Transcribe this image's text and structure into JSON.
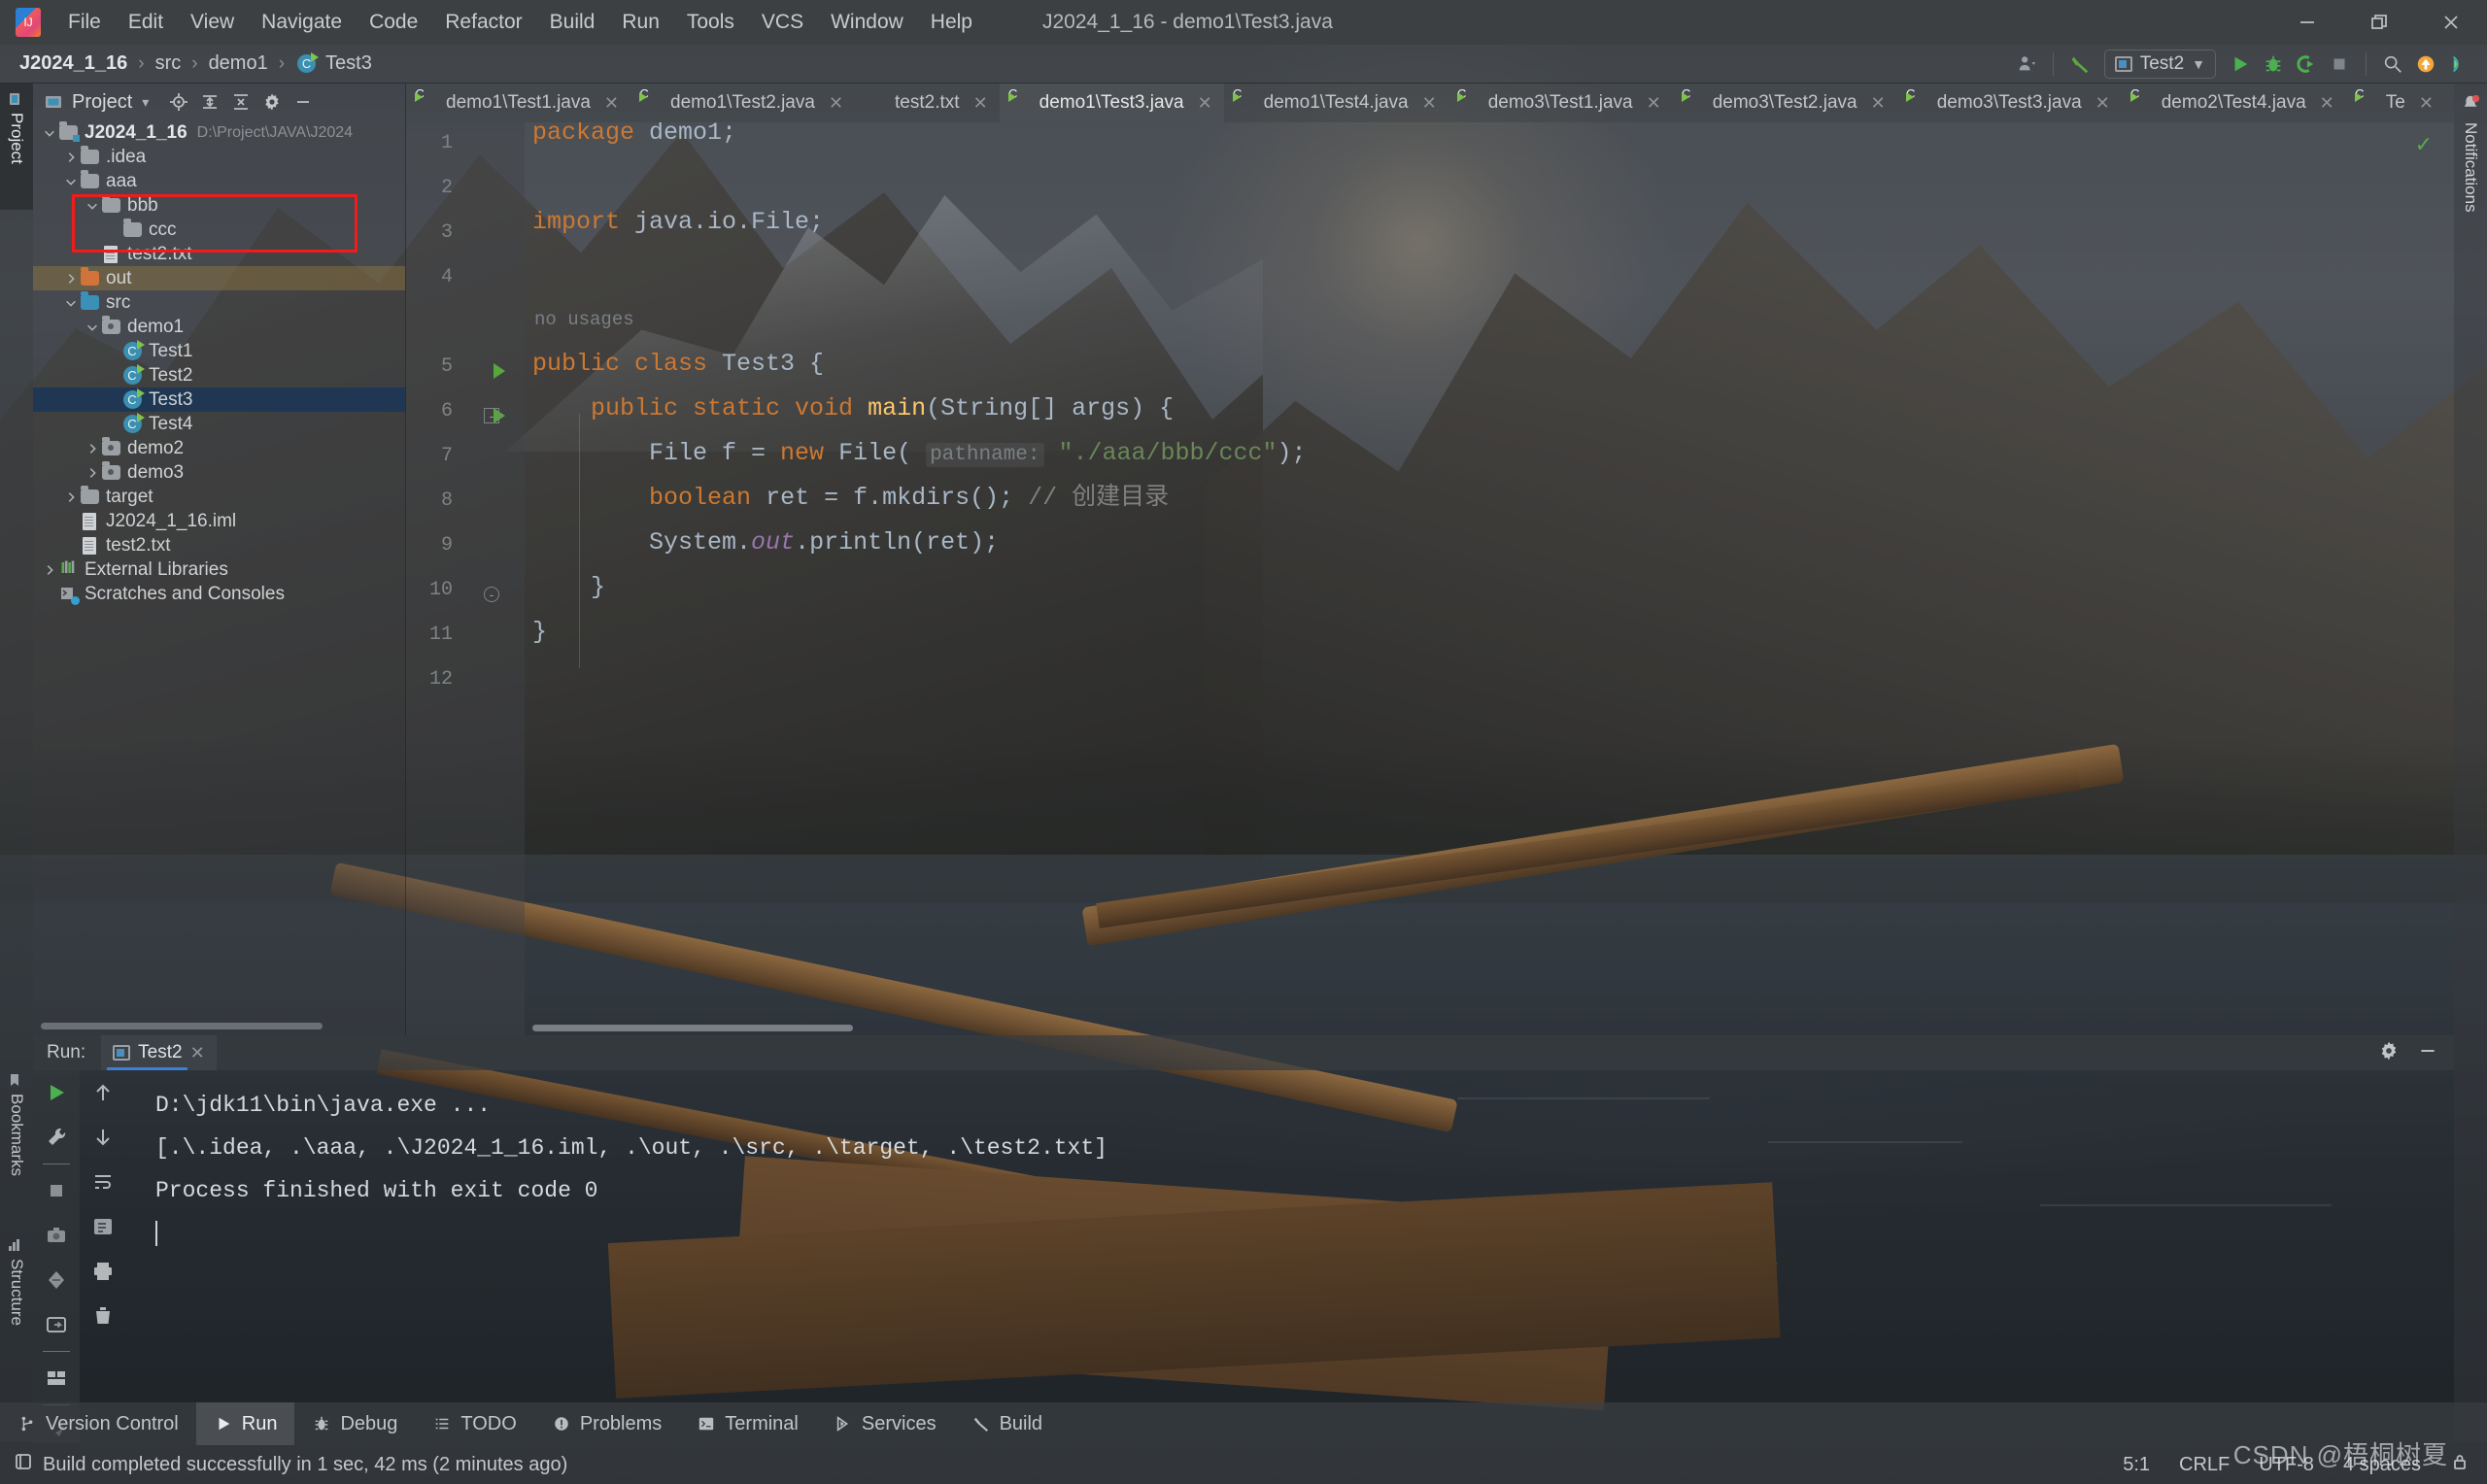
{
  "window": {
    "title": "J2024_1_16 - demo1\\Test3.java",
    "minimize": "—",
    "restore": "❐",
    "close": "✕"
  },
  "menubar": {
    "items": [
      "File",
      "Edit",
      "View",
      "Navigate",
      "Code",
      "Refactor",
      "Build",
      "Run",
      "Tools",
      "VCS",
      "Window",
      "Help"
    ]
  },
  "breadcrumb": {
    "items": [
      "J2024_1_16",
      "src",
      "demo1",
      "Test3"
    ],
    "separator": "›"
  },
  "toolbar": {
    "run_config_label": "Test2",
    "icons": [
      "user-icon",
      "hammer-icon",
      "run-icon",
      "debug-icon",
      "run-coverage-icon",
      "stop-icon",
      "search-icon",
      "update-icon",
      "ide-assistant-icon"
    ],
    "run_config_caret": "▼"
  },
  "left_strip": {
    "project_tab": "Project",
    "bookmarks_tab": "Bookmarks",
    "structure_tab": "Structure"
  },
  "right_strip": {
    "notifications_tab": "Notifications"
  },
  "project_panel": {
    "header_title": "Project",
    "header_caret": "▾",
    "header_icons": [
      "locate-icon",
      "expand-all-icon",
      "collapse-all-icon",
      "settings-icon",
      "hide-icon"
    ],
    "tree": [
      {
        "label": "J2024_1_16",
        "sub": "D:\\Project\\JAVA\\J2024",
        "icon": "project-folder-icon",
        "arrow": "down",
        "indent": 0,
        "bold": true
      },
      {
        "label": ".idea",
        "icon": "folder-grey-icon",
        "arrow": "right",
        "indent": 1
      },
      {
        "label": "aaa",
        "icon": "folder-grey-icon",
        "arrow": "down",
        "indent": 1,
        "highlight_box": true
      },
      {
        "label": "bbb",
        "icon": "folder-grey-icon",
        "arrow": "down",
        "indent": 2,
        "highlight_box": true
      },
      {
        "label": "ccc",
        "icon": "folder-grey-icon",
        "arrow": "none",
        "indent": 3,
        "highlight_box": true
      },
      {
        "label": "test2.txt",
        "icon": "text-file-icon",
        "arrow": "none",
        "indent": 2
      },
      {
        "label": "out",
        "icon": "folder-orange-icon",
        "arrow": "right",
        "indent": 1,
        "row_highlight": true
      },
      {
        "label": "src",
        "icon": "folder-blue-icon",
        "arrow": "down",
        "indent": 1
      },
      {
        "label": "demo1",
        "icon": "package-icon",
        "arrow": "down",
        "indent": 2
      },
      {
        "label": "Test1",
        "icon": "java-class-runnable-icon",
        "arrow": "none",
        "indent": 3
      },
      {
        "label": "Test2",
        "icon": "java-class-runnable-icon",
        "arrow": "none",
        "indent": 3
      },
      {
        "label": "Test3",
        "icon": "java-class-runnable-icon",
        "arrow": "none",
        "indent": 3,
        "selected": true
      },
      {
        "label": "Test4",
        "icon": "java-class-runnable-icon",
        "arrow": "none",
        "indent": 3
      },
      {
        "label": "demo2",
        "icon": "package-icon",
        "arrow": "right",
        "indent": 2
      },
      {
        "label": "demo3",
        "icon": "package-icon",
        "arrow": "right",
        "indent": 2
      },
      {
        "label": "target",
        "icon": "folder-grey-icon",
        "arrow": "right",
        "indent": 1
      },
      {
        "label": "J2024_1_16.iml",
        "icon": "iml-file-icon",
        "arrow": "none",
        "indent": 1
      },
      {
        "label": "test2.txt",
        "icon": "text-file-icon",
        "arrow": "none",
        "indent": 1
      },
      {
        "label": "External Libraries",
        "icon": "libraries-icon",
        "arrow": "right",
        "indent": 0
      },
      {
        "label": "Scratches and Consoles",
        "icon": "scratches-icon",
        "arrow": "none",
        "indent": 0
      }
    ]
  },
  "editor_tabs": {
    "items": [
      {
        "label": "demo1\\Test1.java",
        "icon": "java-class-runnable-icon",
        "active": false
      },
      {
        "label": "demo1\\Test2.java",
        "icon": "java-class-runnable-icon",
        "active": false
      },
      {
        "label": "test2.txt",
        "icon": "text-file-icon",
        "active": false
      },
      {
        "label": "demo1\\Test3.java",
        "icon": "java-class-runnable-icon",
        "active": true
      },
      {
        "label": "demo1\\Test4.java",
        "icon": "java-class-runnable-icon",
        "active": false
      },
      {
        "label": "demo3\\Test1.java",
        "icon": "java-class-runnable-icon",
        "active": false
      },
      {
        "label": "demo3\\Test2.java",
        "icon": "java-class-runnable-icon",
        "active": false
      },
      {
        "label": "demo3\\Test3.java",
        "icon": "java-class-runnable-icon",
        "active": false
      },
      {
        "label": "demo2\\Test4.java",
        "icon": "java-class-runnable-icon",
        "active": false
      },
      {
        "label": "Te",
        "icon": "java-class-runnable-icon",
        "active": false
      }
    ],
    "overflow_caret": "⌄",
    "more_menu": "⋮",
    "close_glyph": "✕"
  },
  "editor": {
    "line_numbers": [
      "1",
      "2",
      "3",
      "4",
      "5",
      "6",
      "7",
      "8",
      "9",
      "10",
      "11",
      "12"
    ],
    "inlay_no_usages": "no usages",
    "code_lines": [
      {
        "n": 1,
        "tokens": [
          {
            "t": "package ",
            "c": "kw"
          },
          {
            "t": "demo1;",
            "c": "ident"
          }
        ]
      },
      {
        "n": 3,
        "tokens": [
          {
            "t": "import ",
            "c": "kw"
          },
          {
            "t": "java.io.File;",
            "c": "ident"
          }
        ]
      },
      {
        "n": 5,
        "tokens": [
          {
            "t": "public class ",
            "c": "kw"
          },
          {
            "t": "Test3 {",
            "c": "ident"
          }
        ]
      },
      {
        "n": 6,
        "tokens": [
          {
            "t": "    public static void ",
            "c": "kw"
          },
          {
            "t": "main",
            "c": "meth"
          },
          {
            "t": "(String[] args) {",
            "c": "ident"
          }
        ]
      },
      {
        "n": 7,
        "tokens": [
          {
            "t": "        File f = ",
            "c": "ident"
          },
          {
            "t": "new ",
            "c": "kw"
          },
          {
            "t": "File( ",
            "c": "ident"
          },
          {
            "t": "pathname:",
            "c": "hint"
          },
          {
            "t": " \"./aaa/bbb/ccc\"",
            "c": "str"
          },
          {
            "t": ");",
            "c": "ident"
          }
        ]
      },
      {
        "n": 8,
        "tokens": [
          {
            "t": "        boolean ",
            "c": "kw"
          },
          {
            "t": "ret = f.mkdirs(); ",
            "c": "ident"
          },
          {
            "t": "// 创建目录",
            "c": "cmt"
          }
        ]
      },
      {
        "n": 9,
        "tokens": [
          {
            "t": "        System.",
            "c": "ident"
          },
          {
            "t": "out",
            "c": "stat"
          },
          {
            "t": ".println(ret);",
            "c": "ident"
          }
        ]
      },
      {
        "n": 10,
        "tokens": [
          {
            "t": "    }",
            "c": "ident"
          }
        ]
      },
      {
        "n": 11,
        "tokens": [
          {
            "t": "}",
            "c": "ident"
          }
        ]
      }
    ],
    "raw_text": "package demo1;\n\nimport java.io.File;\n\npublic class Test3 {\n    public static void main(String[] args) {\n        File f = new File( pathname: \"./aaa/bbb/ccc\");\n        boolean ret = f.mkdirs(); // 创建目录\n        System.out.println(ret);\n    }\n}\n",
    "inspection_ok": "✓"
  },
  "run_window": {
    "label": "Run:",
    "tab_label": "Test2",
    "tab_close": "✕",
    "settings_icon": "gear-icon",
    "hide_icon": "minimize-icon",
    "side_icons": [
      "rerun-icon",
      "wrench-icon",
      "stop-icon",
      "screenshot-icon",
      "dump-threads-icon",
      "restore-layout-icon",
      "layout-icon",
      "pin-icon"
    ],
    "side_icons_2": [
      "scroll-up-icon",
      "scroll-down-icon",
      "soft-wrap-icon",
      "scroll-to-end-icon",
      "print-icon",
      "clear-all-icon"
    ],
    "console_lines": [
      {
        "text": "D:\\jdk11\\bin\\java.exe ...",
        "style": "dim"
      },
      {
        "text": "[.\\.idea, .\\aaa, .\\J2024_1_16.iml, .\\out, .\\src, .\\target, .\\test2.txt]",
        "style": "normal"
      },
      {
        "text": "",
        "style": "normal"
      },
      {
        "text": "Process finished with exit code 0",
        "style": "normal"
      }
    ]
  },
  "status_bar": {
    "tool_tabs": [
      {
        "label": "Version Control",
        "icon": "branch-icon",
        "active": false
      },
      {
        "label": "Run",
        "icon": "run-icon",
        "active": true
      },
      {
        "label": "Debug",
        "icon": "debug-icon",
        "active": false
      },
      {
        "label": "TODO",
        "icon": "todo-icon",
        "active": false
      },
      {
        "label": "Problems",
        "icon": "problems-icon",
        "active": false
      },
      {
        "label": "Terminal",
        "icon": "terminal-icon",
        "active": false
      },
      {
        "label": "Services",
        "icon": "services-icon",
        "active": false
      },
      {
        "label": "Build",
        "icon": "hammer-icon",
        "active": false
      }
    ],
    "message": "Build completed successfully in 1 sec, 42 ms (2 minutes ago)",
    "message_icon": "build-icon",
    "caret_position": "5:1",
    "line_separator": "CRLF",
    "encoding": "UTF-8",
    "indent": "4 spaces",
    "lock_icon": "lock-icon"
  },
  "watermark": {
    "text": "CSDN @梧桐树夏"
  },
  "colors": {
    "accent_blue": "#3c7fd4",
    "selection_blue": "#1f3753",
    "run_green": "#55a73e",
    "keyword_orange": "#cc7832",
    "string_green": "#6a8759",
    "method_yellow": "#ffc66d",
    "static_purple": "#9876aa",
    "red_annotation": "#f01c1c",
    "chrome_grey": "#3c4043"
  }
}
